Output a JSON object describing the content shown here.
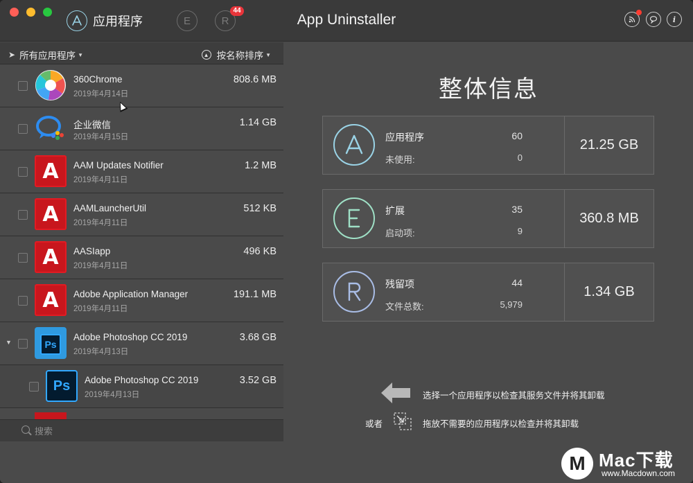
{
  "window": {
    "title": "App Uninstaller",
    "tabs": [
      {
        "label": "应用程序",
        "icon": "app-store-icon"
      },
      {
        "label": "",
        "icon": "extensions-e-icon"
      },
      {
        "label": "",
        "icon": "remains-r-icon",
        "badge": "44"
      }
    ]
  },
  "filterbar": {
    "filter_label": "所有应用程序",
    "sort_label": "按名称排序"
  },
  "apps": [
    {
      "name": "360Chrome",
      "date": "2019年4月14日",
      "size": "808.6 MB",
      "icon": "360chrome-icon"
    },
    {
      "name": "企业微信",
      "date": "2019年4月15日",
      "size": "1.14 GB",
      "icon": "wecom-icon"
    },
    {
      "name": "AAM Updates Notifier",
      "date": "2019年4月11日",
      "size": "1.2 MB",
      "icon": "adobe-icon"
    },
    {
      "name": "AAMLauncherUtil",
      "date": "2019年4月11日",
      "size": "512 KB",
      "icon": "adobe-icon"
    },
    {
      "name": "AASIapp",
      "date": "2019年4月11日",
      "size": "496 KB",
      "icon": "adobe-icon"
    },
    {
      "name": "Adobe Application Manager",
      "date": "2019年4月11日",
      "size": "191.1 MB",
      "icon": "adobe-icon"
    },
    {
      "name": "Adobe Photoshop CC 2019",
      "date": "2019年4月13日",
      "size": "3.68 GB",
      "icon": "photoshop-folder-icon"
    },
    {
      "name": "Adobe Photoshop CC 2019",
      "date": "2019年4月13日",
      "size": "3.52 GB",
      "icon": "photoshop-icon"
    }
  ],
  "search": {
    "placeholder": "搜索"
  },
  "overview": {
    "title": "整体信息",
    "cards": [
      {
        "label1": "应用程序",
        "value1": "60",
        "label2": "未使用:",
        "value2": "0",
        "total": "21.25 GB",
        "icon": "app-store-icon",
        "color": "#9ad3e6"
      },
      {
        "label1": "扩展",
        "value1": "35",
        "label2": "启动项:",
        "value2": "9",
        "total": "360.8 MB",
        "icon": "extensions-e-icon",
        "color": "#9fe0c6"
      },
      {
        "label1": "残留项",
        "value1": "44",
        "label2": "文件总数:",
        "value2": "5,979",
        "total": "1.34 GB",
        "icon": "remains-r-icon",
        "color": "#a9bde6"
      }
    ],
    "hint_select": "选择一个应用程序以检查其服务文件并将其卸载",
    "or_label": "或者",
    "hint_drop": "拖放不需要的应用程序以检查并将其卸载"
  },
  "watermark": {
    "brand": "Mac下载",
    "url": "www.Macdown.com",
    "logo_letter": "M"
  }
}
